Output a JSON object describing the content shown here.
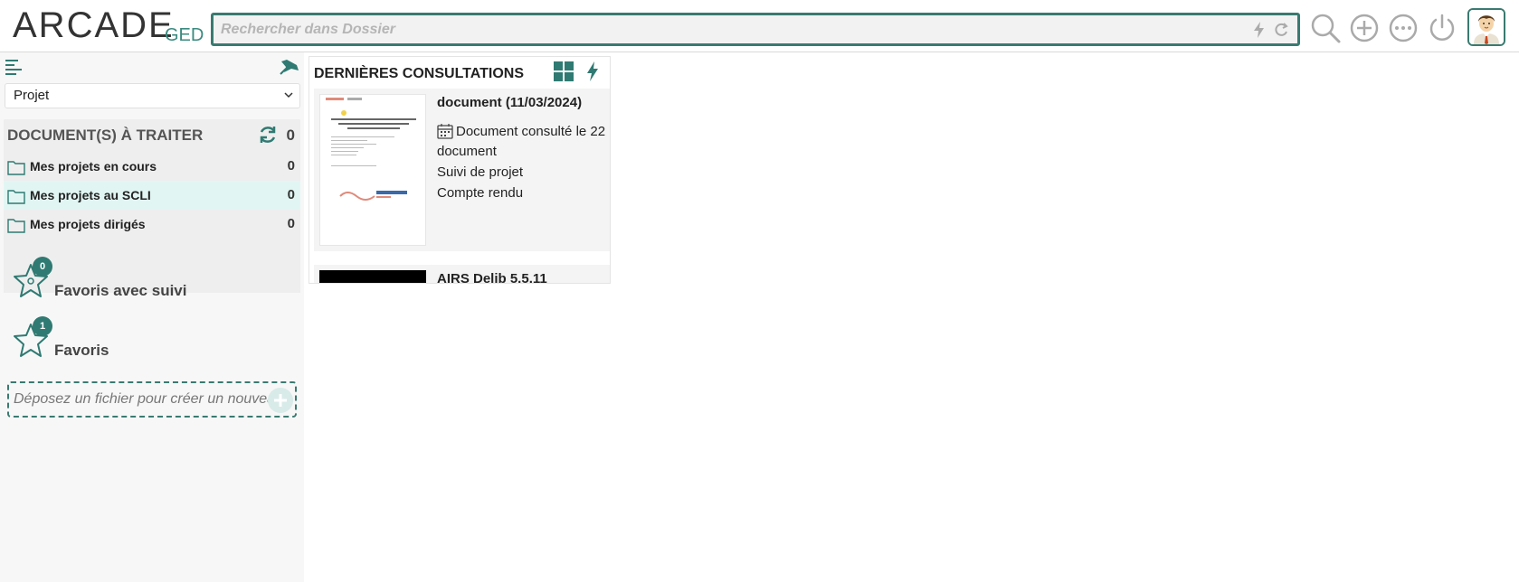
{
  "header": {
    "logo_main": "ARCADE",
    "logo_sub": "GED",
    "search_placeholder": "Rechercher dans Dossier",
    "icons": [
      "search-icon",
      "add-icon",
      "more-icon",
      "power-icon",
      "avatar-icon"
    ]
  },
  "sidebar": {
    "select_value": "Projet",
    "todo": {
      "title": "DOCUMENT(S) À TRAITER",
      "count": "0",
      "folders": [
        {
          "label": "Mes projets en cours",
          "count": "0",
          "active": false
        },
        {
          "label": "Mes projets au SCLI",
          "count": "0",
          "active": true
        },
        {
          "label": "Mes projets dirigés",
          "count": "0",
          "active": false
        }
      ]
    },
    "favorites": [
      {
        "label": "Favoris avec suivi",
        "badge": "0"
      },
      {
        "label": "Favoris",
        "badge": "1"
      }
    ],
    "drop_placeholder": "Déposez un fichier pour créer un nouveau"
  },
  "panel": {
    "title": "DERNIÈRES CONSULTATIONS",
    "cards": [
      {
        "title": "document (11/03/2024)",
        "consulted": "Document consulté le 22",
        "type": "document",
        "category": "Suivi de projet",
        "subcategory": "Compte rendu"
      },
      {
        "title": "AIRS Delib 5.5.11"
      }
    ]
  },
  "colors": {
    "accent": "#2f7a72",
    "active_row": "#e1f6f3"
  }
}
